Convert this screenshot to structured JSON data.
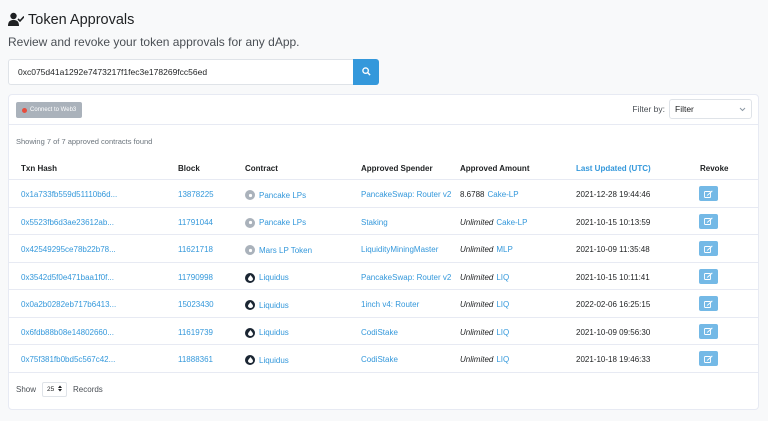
{
  "header": {
    "title": "Token Approvals",
    "subtitle": "Review and revoke your token approvals for any dApp."
  },
  "search": {
    "value": "0xc075d41a1292e7473217f1fec3e178269fcc56ed"
  },
  "toolbar": {
    "connect_label": "Connect to Web3",
    "filter_label": "Filter by:",
    "filter_value": "Filter"
  },
  "summary": "Showing 7 of 7 approved contracts found",
  "table": {
    "columns": [
      "Txn Hash",
      "Block",
      "Contract",
      "Approved Spender",
      "Approved Amount",
      "Last Updated (UTC)",
      "Revoke"
    ],
    "rows": [
      {
        "hash": "0x1a733fb559d51110b6d...",
        "block": "13878225",
        "contract": "Pancake LPs",
        "icon": "grey",
        "spender": "PancakeSwap: Router v2",
        "amount": "8.6788",
        "token": "Cake-LP",
        "updated": "2021-12-28 19:44:46"
      },
      {
        "hash": "0x5523fb6d3ae23612ab...",
        "block": "11791044",
        "contract": "Pancake LPs",
        "icon": "grey",
        "spender": "Staking",
        "amount": "Unlimited",
        "token": "Cake-LP",
        "updated": "2021-10-15 10:13:59"
      },
      {
        "hash": "0x42549295ce78b22b78...",
        "block": "11621718",
        "contract": "Mars LP Token",
        "icon": "grey",
        "spender": "LiquidityMiningMaster",
        "amount": "Unlimited",
        "token": "MLP",
        "updated": "2021-10-09 11:35:48"
      },
      {
        "hash": "0x3542d5f0e471baa1f0f...",
        "block": "11790998",
        "contract": "Liquidus",
        "icon": "dark",
        "spender": "PancakeSwap: Router v2",
        "amount": "Unlimited",
        "token": "LIQ",
        "updated": "2021-10-15 10:11:41"
      },
      {
        "hash": "0x0a2b0282eb717b6413...",
        "block": "15023430",
        "contract": "Liquidus",
        "icon": "dark",
        "spender": "1inch v4: Router",
        "amount": "Unlimited",
        "token": "LIQ",
        "updated": "2022-02-06 16:25:15"
      },
      {
        "hash": "0x6fdb88b08e14802660...",
        "block": "11619739",
        "contract": "Liquidus",
        "icon": "dark",
        "spender": "CodiStake",
        "amount": "Unlimited",
        "token": "LIQ",
        "updated": "2021-10-09 09:56:30"
      },
      {
        "hash": "0x75f381fb0bd5c567c42...",
        "block": "11888361",
        "contract": "Liquidus",
        "icon": "dark",
        "spender": "CodiStake",
        "amount": "Unlimited",
        "token": "LIQ",
        "updated": "2021-10-18 19:46:33"
      }
    ]
  },
  "footer": {
    "show_label": "Show",
    "page_size": "25",
    "records_label": "Records"
  },
  "colors": {
    "accent": "#3498db",
    "revoke": "#74b9e6"
  }
}
